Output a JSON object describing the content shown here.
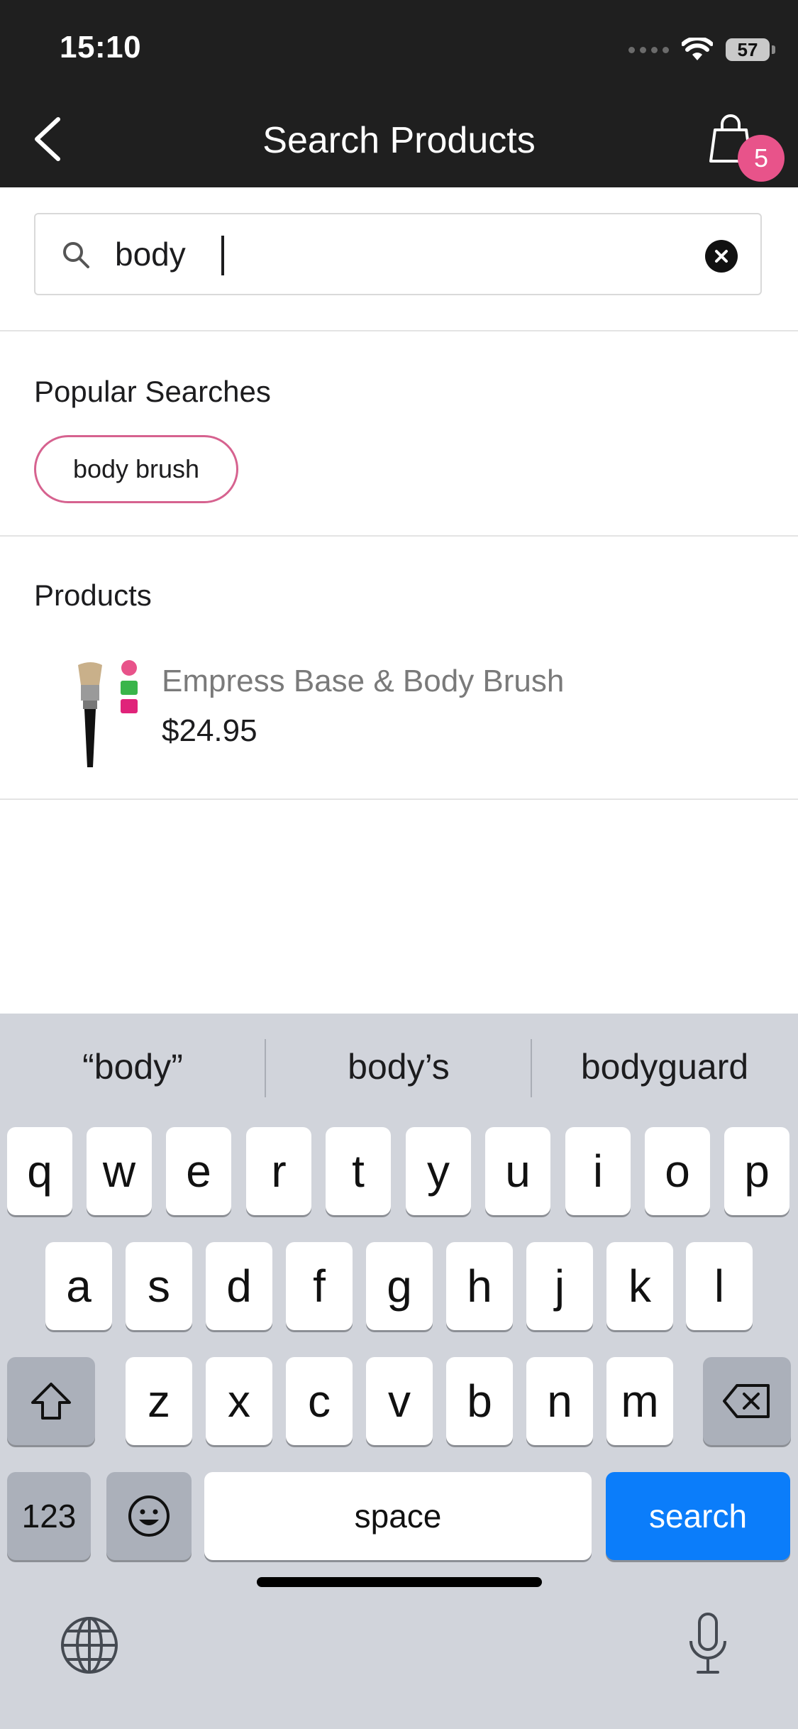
{
  "status_bar": {
    "time": "15:10",
    "battery": "57"
  },
  "header": {
    "title": "Search Products",
    "cart_count": "5"
  },
  "search": {
    "query": "body",
    "placeholder": ""
  },
  "popular": {
    "title": "Popular Searches",
    "chips": [
      "body brush"
    ]
  },
  "products": {
    "title": "Products",
    "items": [
      {
        "name": "Empress Base & Body Brush",
        "price": "$24.95"
      }
    ]
  },
  "keyboard": {
    "suggestions": [
      "“body”",
      "body’s",
      "bodyguard"
    ],
    "row1": [
      "q",
      "w",
      "e",
      "r",
      "t",
      "y",
      "u",
      "i",
      "o",
      "p"
    ],
    "row2": [
      "a",
      "s",
      "d",
      "f",
      "g",
      "h",
      "j",
      "k",
      "l"
    ],
    "row3": [
      "z",
      "x",
      "c",
      "v",
      "b",
      "n",
      "m"
    ],
    "numbers_label": "123",
    "space_label": "space",
    "search_label": "search"
  },
  "colors": {
    "accent": "#e8538a",
    "chip_border": "#d6628f",
    "key_blue": "#0b7dfa"
  }
}
